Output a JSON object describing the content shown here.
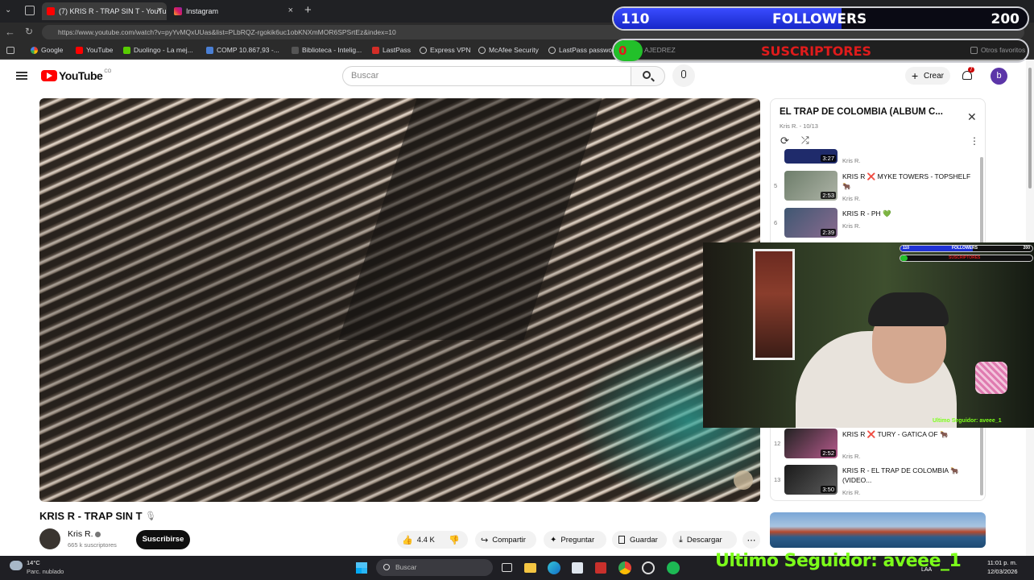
{
  "tabs": [
    {
      "label": "(7) KRIS R - TRAP SIN T - YouTube",
      "close": "×"
    },
    {
      "label": "Instagram",
      "close": "×"
    }
  ],
  "new_tab": "+",
  "url": "https://www.youtube.com/watch?v=pyYvMQxUUas&list=PLbRQZ-rgokik6uc1obKNXmMOR6SPSrtEz&index=10",
  "bookmarks": [
    "Google",
    "YouTube",
    "Duolingo - La mej...",
    "COMP 10.867,93 -...",
    "Biblioteca - Intelig...",
    "LastPass",
    "Express VPN",
    "McAfee Security",
    "LastPass passwor",
    "AJEDREZ",
    "Otros favoritos"
  ],
  "youtube": {
    "logo": "YouTube",
    "country": "CO",
    "search_placeholder": "Buscar",
    "create_label": "Crear",
    "notif_count": "7",
    "avatar_letter": "b"
  },
  "video": {
    "title": "KRIS R - TRAP SIN T",
    "channel": "Kris R.",
    "subscribers": "665 k suscriptores",
    "subscribe_label": "Suscribirse",
    "likes": "4.4 K",
    "share_label": "Compartir",
    "ask_label": "Preguntar",
    "save_label": "Guardar",
    "download_label": "Descargar"
  },
  "playlist": {
    "title": "EL TRAP DE COLOMBIA (ÁLBUM C...",
    "owner_progress": "Kris R. - 10/13",
    "items": [
      {
        "num": "",
        "title": "",
        "channel": "Kris R.",
        "duration": "3:27"
      },
      {
        "num": "5",
        "title": "KRIS R ❌ MYKE TOWERS - TOPSHELF 🐂",
        "channel": "Kris R.",
        "duration": "2:53"
      },
      {
        "num": "6",
        "title": "KRIS R - PH 💚",
        "channel": "Kris R.",
        "duration": "2:39"
      },
      {
        "num": "12",
        "title": "KRIS R ❌ TURY - GATICA OF 🐂",
        "channel": "Kris R.",
        "duration": "2:52"
      },
      {
        "num": "13",
        "title": "KRIS R - EL TRAP DE COLOMBIA 🐂 (VIDEO...",
        "channel": "Kris R.",
        "duration": "3:50"
      }
    ]
  },
  "overlay": {
    "followers_current": "110",
    "followers_label": "FOLLOWERS",
    "followers_goal": "200",
    "subs_current": "0",
    "subs_label": "SUSCRIPTORES",
    "last_follower": "Ultimo Seguidor: aveee_1",
    "followers_progress": 0.55
  },
  "webcam": {
    "mini_followers_current": "110",
    "mini_followers_label": "FOLLOWERS",
    "mini_followers_goal": "200",
    "mini_subs_label": "SUSCRIPTORES",
    "mini_last_follower": "Ultimo Seguidor: aveee_1"
  },
  "taskbar": {
    "temperature": "14°C",
    "weather": "Parc. nublado",
    "search_placeholder": "Buscar",
    "language": "LAA",
    "time": "11:01 p. m.",
    "date": "12/03/2026"
  }
}
